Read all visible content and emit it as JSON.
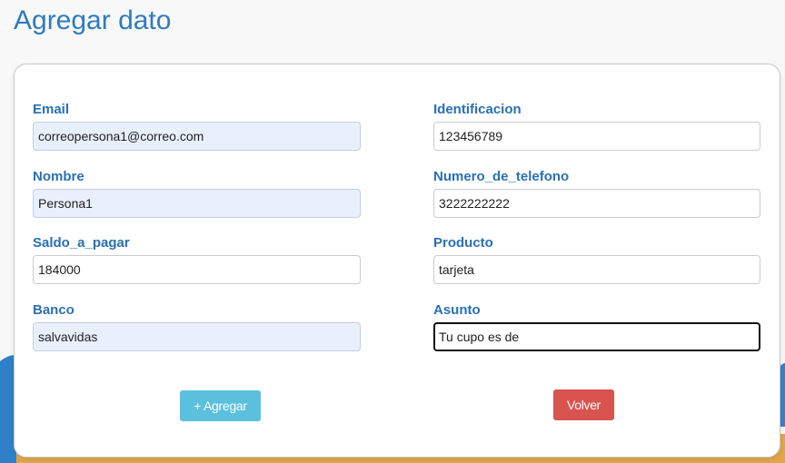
{
  "page_title": "Agregar dato",
  "form": {
    "email": {
      "label": "Email",
      "value": "correopersona1@correo.com"
    },
    "identificacion": {
      "label": "Identificacion",
      "value": "123456789"
    },
    "nombre": {
      "label": "Nombre",
      "value": "Persona1"
    },
    "numero_de_telefono": {
      "label": "Numero_de_telefono",
      "value": "3222222222"
    },
    "saldo_a_pagar": {
      "label": "Saldo_a_pagar",
      "value": "184000"
    },
    "producto": {
      "label": "Producto",
      "value": "tarjeta"
    },
    "banco": {
      "label": "Banco",
      "value": "salvavidas"
    },
    "asunto": {
      "label": "Asunto",
      "value": "Tu cupo es de"
    }
  },
  "buttons": {
    "add_label": "+ Agregar",
    "back_label": "Volver"
  },
  "colors": {
    "title": "#2f7bbf",
    "label": "#2a70b3",
    "add_button": "#5bc0de",
    "back_button": "#d9534f",
    "autofill_bg": "#e8f0fe",
    "decor_blue": "#2f80c8",
    "decor_orange": "#e0a548"
  }
}
